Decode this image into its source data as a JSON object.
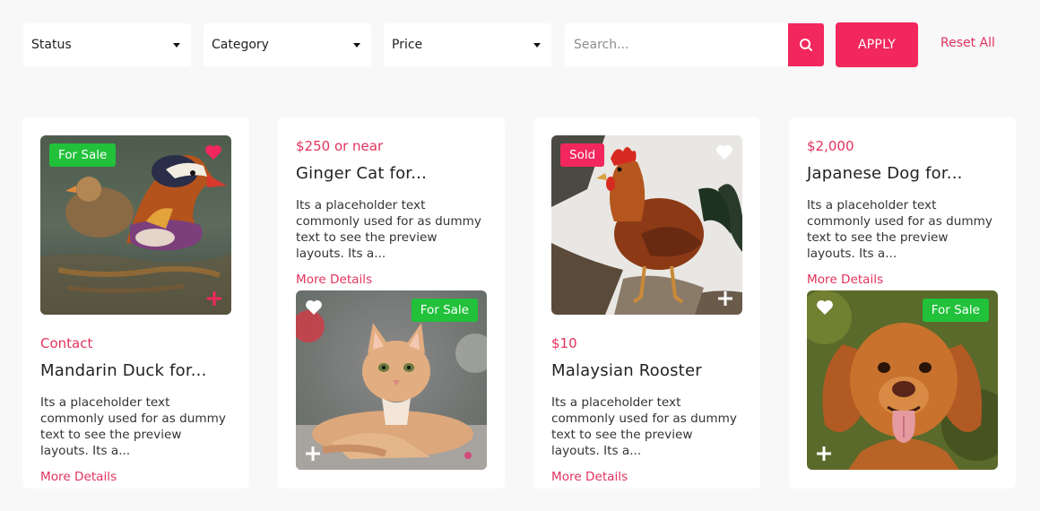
{
  "colors": {
    "accent": "#f2275d",
    "sale_badge": "#21c13a",
    "sold_badge": "#f2275d",
    "page_bg": "#f8f8f8"
  },
  "filters": {
    "status": {
      "label": "Status",
      "icon": "caret-down-icon"
    },
    "category": {
      "label": "Category",
      "icon": "caret-down-icon"
    },
    "price": {
      "label": "Price",
      "icon": "caret-down-icon"
    },
    "search": {
      "placeholder": "Search...",
      "value": "",
      "button_icon": "search-icon"
    },
    "apply_label": "APPLY",
    "reset_label": "Reset All"
  },
  "listings": [
    {
      "price": "Contact",
      "title": "Mandarin Duck for...",
      "description": "Its a placeholder text commonly used for as dummy text to see the preview layouts. Its a...",
      "link": "More Details",
      "badge": "For Sale",
      "favorited": true,
      "image": "mandarin-duck-photo"
    },
    {
      "price": "$250 or near",
      "title": "Ginger Cat for...",
      "description": "Its a placeholder text commonly used for as dummy text to see the preview layouts. Its a...",
      "link": "More Details",
      "badge": "For Sale",
      "favorited": false,
      "image": "ginger-cat-photo"
    },
    {
      "price": "$10",
      "title": "Malaysian Rooster",
      "description": "Its a placeholder text commonly used for as dummy text to see the preview layouts. Its a...",
      "link": "More Details",
      "badge": "Sold",
      "favorited": false,
      "image": "rooster-photo"
    },
    {
      "price": "$2,000",
      "title": "Japanese Dog for...",
      "description": "Its a placeholder text commonly used for as dummy text to see the preview layouts. Its a...",
      "link": "More Details",
      "badge": "For Sale",
      "favorited": false,
      "image": "golden-dog-photo"
    }
  ]
}
